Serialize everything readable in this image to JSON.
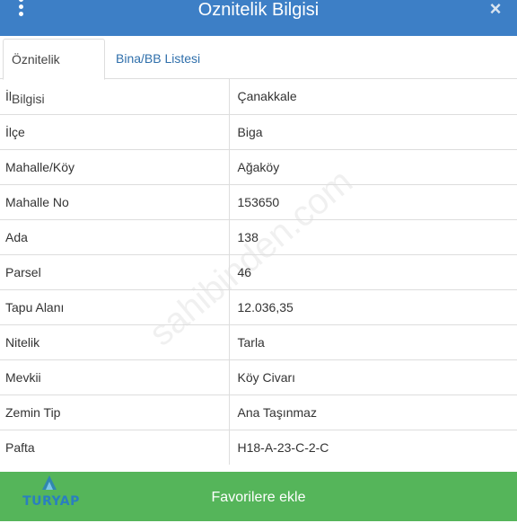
{
  "header": {
    "title": "Oznitelik Bilgisi",
    "menu_icon": "vertical-dots-icon",
    "close_label": "×"
  },
  "tabs": [
    {
      "label": "Öznitelik Bilgisi",
      "active": true
    },
    {
      "label": "Bina/BB Listesi",
      "active": false
    }
  ],
  "attributes": [
    {
      "key": "İl",
      "value": "Çanakkale"
    },
    {
      "key": "İlçe",
      "value": "Biga"
    },
    {
      "key": "Mahalle/Köy",
      "value": "Ağaköy"
    },
    {
      "key": "Mahalle No",
      "value": "153650"
    },
    {
      "key": "Ada",
      "value": "138"
    },
    {
      "key": "Parsel",
      "value": "46"
    },
    {
      "key": "Tapu Alanı",
      "value": "12.036,35"
    },
    {
      "key": "Nitelik",
      "value": "Tarla"
    },
    {
      "key": "Mevkii",
      "value": "Köy Civarı"
    },
    {
      "key": "Zemin Tip",
      "value": "Ana Taşınmaz"
    },
    {
      "key": "Pafta",
      "value": "H18-A-23-C-2-C"
    }
  ],
  "footer": {
    "favorite_label": "Favorilere ekle",
    "logo_text": "TURYAP"
  },
  "watermark_text": "sahibinden.com",
  "colors": {
    "header": "#3d7fc6",
    "footer": "#55b55a",
    "tab_link": "#2f6fab",
    "border": "#dddddd"
  }
}
